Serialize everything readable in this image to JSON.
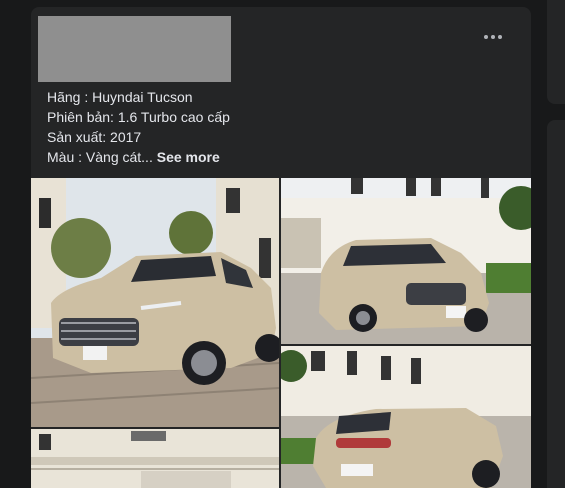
{
  "post": {
    "line1": "Hãng : Huyndai Tucson",
    "line2": "Phiên bản: 1.6 Turbo cao cấp",
    "line3": "Sản xuất: 2017",
    "line4_prefix": "Màu : Vàng cát... ",
    "see_more": "See more"
  },
  "icons": {
    "more": "more-horizontal-icon"
  },
  "colors": {
    "background": "#18191a",
    "card": "#242526",
    "text": "#e4e6eb",
    "car": "#cdbfa3"
  }
}
